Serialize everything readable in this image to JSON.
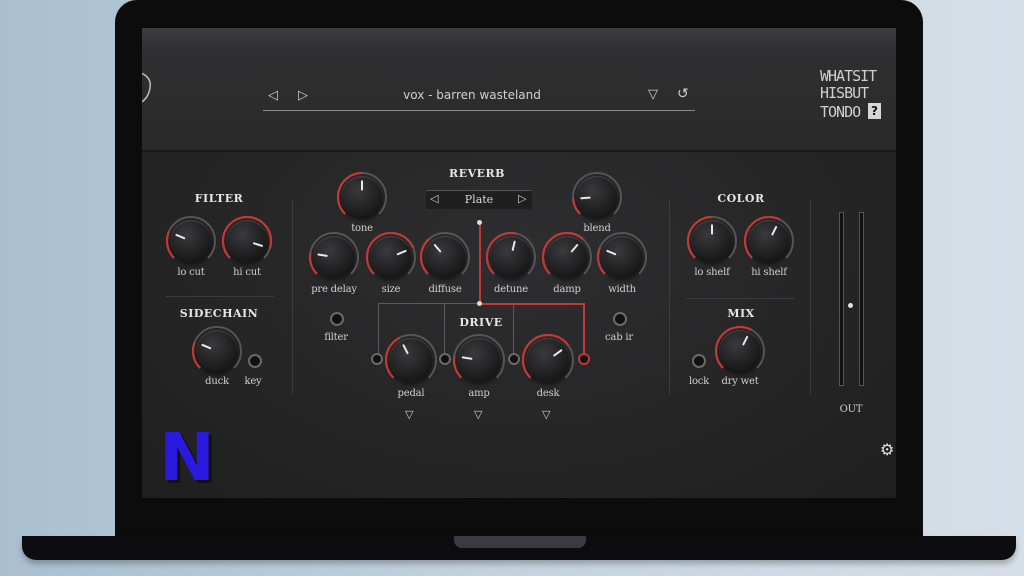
{
  "header": {
    "preset_name": "vox - barren wasteland",
    "logo_lines": [
      "WHATSIT",
      "HISBUT",
      "TONDO"
    ]
  },
  "sections": {
    "filter": "FILTER",
    "sidechain": "SIDECHAIN",
    "reverb": "REVERB",
    "drive": "DRIVE",
    "color": "COLOR",
    "mix": "MIX"
  },
  "reverb": {
    "type": "Plate"
  },
  "knobs": {
    "lo_cut": "lo cut",
    "hi_cut": "hi cut",
    "duck": "duck",
    "tone": "tone",
    "blend": "blend",
    "pre_delay": "pre delay",
    "size": "size",
    "diffuse": "diffuse",
    "detune": "detune",
    "damp": "damp",
    "width": "width",
    "pedal": "pedal",
    "amp": "amp",
    "desk": "desk",
    "lo_shelf": "lo shelf",
    "hi_shelf": "hi shelf",
    "dry_wet": "dry wet"
  },
  "labels": {
    "key": "key",
    "filter": "filter",
    "cab_ir": "cab ir",
    "lock": "lock",
    "out": "OUT"
  },
  "watermark": "N",
  "colors": {
    "accent": "#c23838",
    "panel": "#262627",
    "watermark": "#2a1ae0"
  }
}
